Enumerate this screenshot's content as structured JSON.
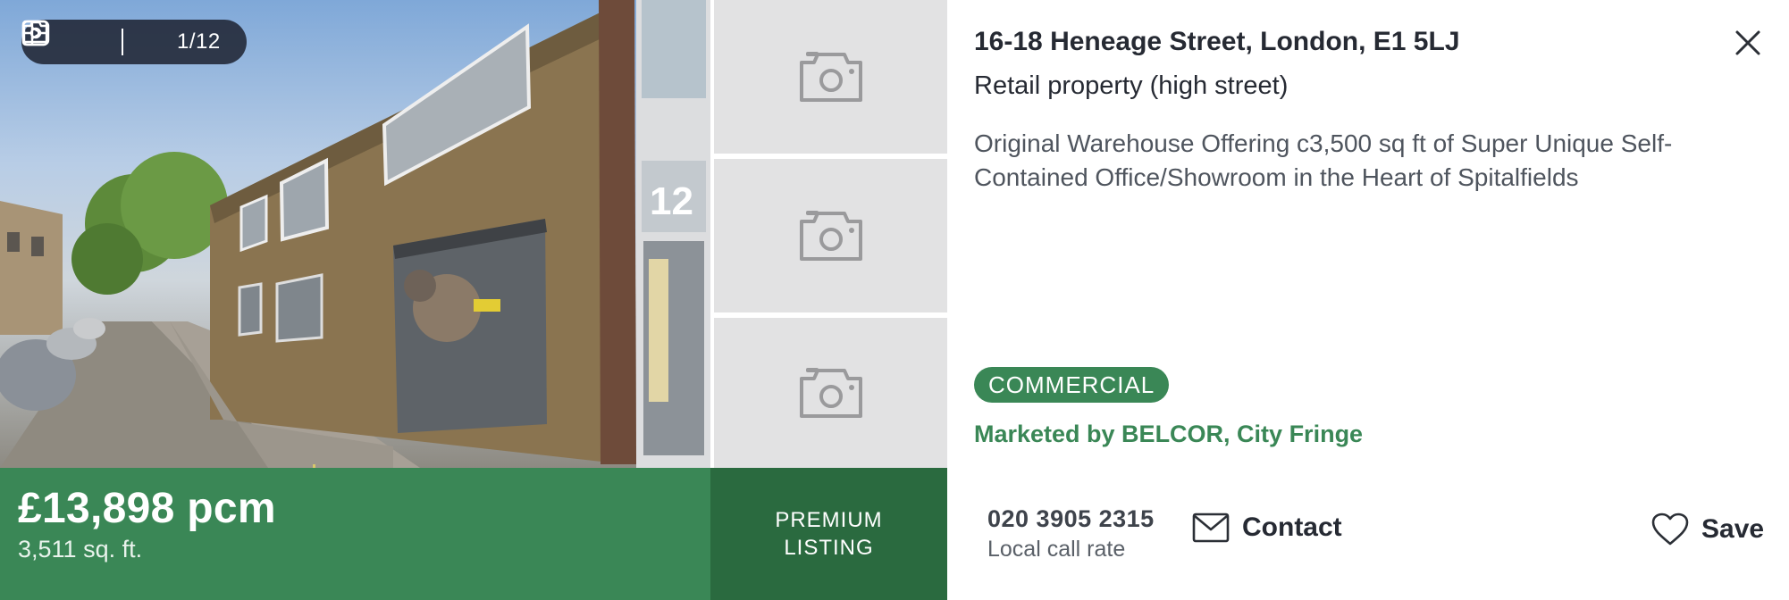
{
  "gallery": {
    "counter": "1/12",
    "icons": [
      "floorplan-icon",
      "video-icon",
      "camera-icon"
    ],
    "thumbnail_icon": "camera-icon"
  },
  "price": {
    "amount": "£13,898 pcm",
    "size": "3,511 sq. ft."
  },
  "premium": {
    "line1": "PREMIUM",
    "line2": "LISTING"
  },
  "listing": {
    "address": "16-18 Heneage Street, London, E1 5LJ",
    "property_type": "Retail property (high street)",
    "description": "Original Warehouse Offering c3,500 sq ft of Super Unique Self-Contained Office/Showroom in the Heart of Spitalfields",
    "badge": "COMMERCIAL",
    "marketed_by": "Marketed by BELCOR, City Fringe"
  },
  "contact": {
    "phone": "020 3905 2315",
    "call_rate": "Local call rate",
    "contact_label": "Contact",
    "save_label": "Save"
  },
  "colors": {
    "brand_green": "#3a8756",
    "dark_green": "#2a6a3f",
    "thumb_grey": "#e2e2e3"
  }
}
